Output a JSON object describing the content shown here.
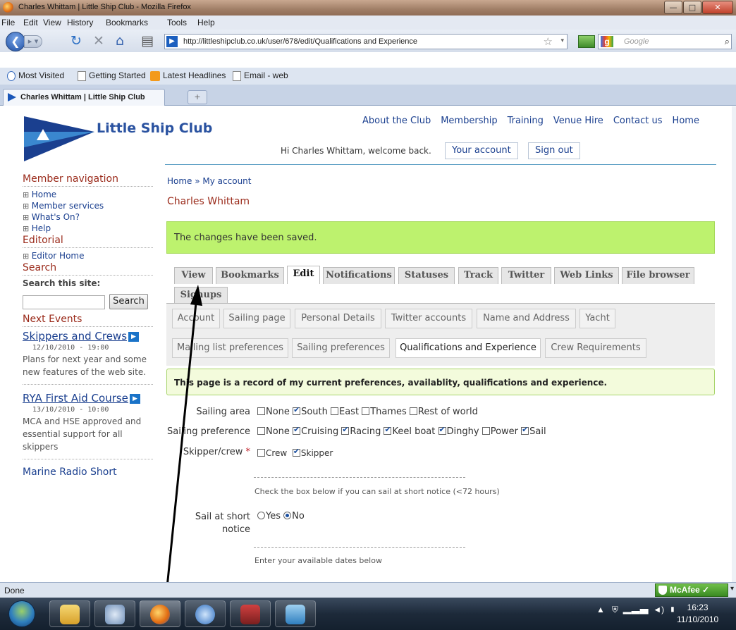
{
  "window": {
    "title": "Charles Whittam | Little Ship Club - Mozilla Firefox"
  },
  "menu": [
    "File",
    "Edit",
    "View",
    "History",
    "Bookmarks",
    "Tools",
    "Help"
  ],
  "toolbar": {
    "url": "http://littleshipclub.co.uk/user/678/edit/Qualifications and Experience",
    "search_placeholder": "Google"
  },
  "bookmarks": [
    "Most Visited",
    "Getting Started",
    "Latest Headlines",
    "Email - web"
  ],
  "browser_tab": {
    "title": "Charles Whittam | Little Ship Club",
    "new_tab": "+"
  },
  "site": {
    "name": "Little Ship Club",
    "top_nav": [
      "About the Club",
      "Membership",
      "Training",
      "Venue Hire",
      "Contact us",
      "Home"
    ],
    "welcome": "Hi Charles Whittam, welcome back.",
    "your_account": "Your account",
    "sign_out": "Sign out"
  },
  "sidebar": {
    "member_nav_heading": "Member navigation",
    "member_nav": [
      "Home",
      "Member services",
      "What's On?",
      "Help"
    ],
    "editorial_heading": "Editorial",
    "editorial": [
      "Editor Home"
    ],
    "search_heading": "Search",
    "search_label": "Search this site:",
    "search_button": "Search",
    "events_heading": "Next Events",
    "events": [
      {
        "title": "Skippers and Crews",
        "date": "12/10/2010 - 19:00",
        "desc": "Plans for next year and some new features of the web site."
      },
      {
        "title": "RYA First Aid Course",
        "date": "13/10/2010 - 10:00",
        "desc": "MCA and HSE approved and essential support for all skippers"
      },
      {
        "title": "Marine Radio Short"
      }
    ]
  },
  "main": {
    "breadcrumb": "Home » My account",
    "user_name": "Charles Whittam",
    "status_message": "The changes have been saved.",
    "tabs": [
      "View",
      "Bookmarks",
      "Edit",
      "Notifications",
      "Statuses",
      "Track",
      "Twitter",
      "Web Links",
      "File browser",
      "Signups"
    ],
    "subtabs": [
      "Account",
      "Sailing page",
      "Personal Details",
      "Twitter accounts",
      "Name and Address",
      "Yacht",
      "Mailing list preferences",
      "Sailing preferences",
      "Qualifications and Experience",
      "Crew Requirements"
    ],
    "info": "This page is a record of my current preferences, availablity, qualifications and experience.",
    "form": {
      "sailing_area": {
        "label": "Sailing area",
        "options": [
          {
            "label": "None",
            "checked": false
          },
          {
            "label": "South",
            "checked": true
          },
          {
            "label": "East",
            "checked": false
          },
          {
            "label": "Thames",
            "checked": false
          },
          {
            "label": "Rest of world",
            "checked": false
          }
        ]
      },
      "sailing_preference": {
        "label": "Sailing preference",
        "options": [
          {
            "label": "None",
            "checked": false
          },
          {
            "label": "Cruising",
            "checked": true
          },
          {
            "label": "Racing",
            "checked": true
          },
          {
            "label": "Keel boat",
            "checked": true
          },
          {
            "label": "Dinghy",
            "checked": true
          },
          {
            "label": "Power",
            "checked": false
          },
          {
            "label": "Sail",
            "checked": true
          }
        ]
      },
      "skipper_crew": {
        "label": "Skipper/crew",
        "required_mark": "*",
        "options": [
          {
            "label": "Crew",
            "checked": false
          },
          {
            "label": "Skipper",
            "checked": true
          }
        ]
      },
      "short_notice_help": "Check the box below if you can sail at short notice (<72 hours)",
      "short_notice": {
        "label_line1": "Sail at short",
        "label_line2": "notice",
        "options": [
          {
            "label": "Yes",
            "selected": false
          },
          {
            "label": "No",
            "selected": true
          }
        ]
      },
      "dates_help": "Enter your available dates below"
    }
  },
  "statusbar": {
    "status": "Done",
    "mcafee": "McAfee"
  },
  "taskbar": {
    "time": "16:23",
    "date": "11/10/2010"
  },
  "colors": {
    "link": "#1a3f8f",
    "heading": "#9a2a1a",
    "saved_bg": "#bdf26e",
    "info_bg": "#f3fbdc"
  }
}
